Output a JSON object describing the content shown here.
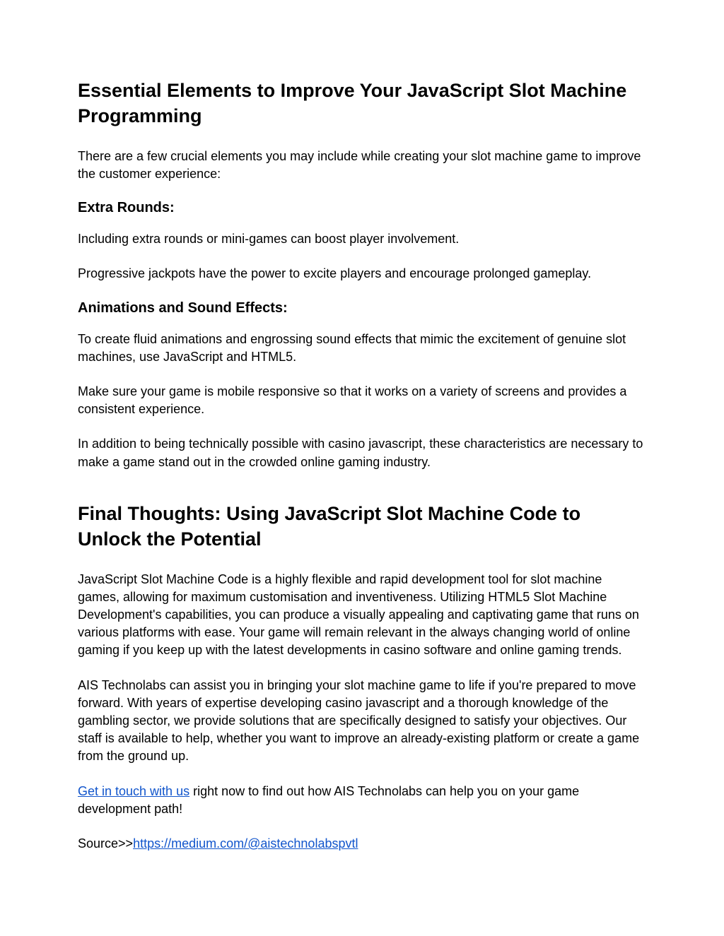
{
  "heading1": "Essential Elements to Improve Your JavaScript Slot Machine Programming",
  "intro": "There are a few crucial elements you may include while creating your slot machine game to improve the customer experience:",
  "sub1": "Extra Rounds:",
  "p1": "Including extra rounds or mini-games can boost player involvement.",
  "p2": "Progressive jackpots have the power to excite players and encourage prolonged gameplay.",
  "sub2": "Animations and Sound Effects:",
  "p3": "To create fluid animations and engrossing sound effects that mimic the excitement of genuine slot machines, use JavaScript and HTML5.",
  "p4": "Make sure your game is mobile responsive so that it works on a variety of screens and provides a consistent experience.",
  "p5": "In addition to being technically possible with casino javascript, these characteristics are necessary to make a game stand out in the crowded online gaming industry.",
  "heading2": "Final Thoughts: Using JavaScript Slot Machine Code to Unlock the Potential",
  "p6": "JavaScript Slot Machine Code is a highly flexible and rapid development tool for slot machine games, allowing for maximum customisation and inventiveness. Utilizing HTML5 Slot Machine Development's capabilities, you can produce a visually appealing and captivating game that runs on various platforms with ease. Your game will remain relevant in the always changing world of online gaming if you keep up with the latest developments in casino software and online gaming trends.",
  "p7": "AIS Technolabs can assist you in bringing your slot machine game to life if you're prepared to move forward. With years of expertise developing casino javascript and a thorough knowledge of the gambling sector, we provide solutions that are specifically designed to satisfy your objectives. Our staff is available to help, whether you want to improve an already-existing platform or create a game from the ground up.",
  "contact_link_text": "Get in touch with us",
  "contact_tail": " right now to find out how AIS Technolabs can help you on your game development path!",
  "source_prefix": "Source>>",
  "source_url": "https://medium.com/@aistechnolabspvtl"
}
